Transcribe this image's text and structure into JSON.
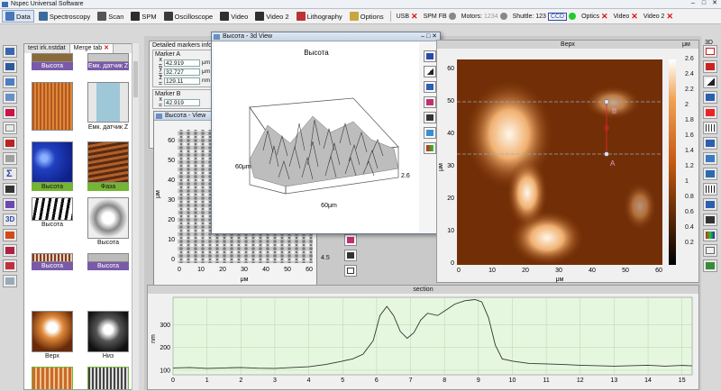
{
  "app": {
    "title": "Nspec Universal Software"
  },
  "toolbar": {
    "items": [
      "Data",
      "Spectroscopy",
      "Scan",
      "SPM",
      "Oscilloscope",
      "Video",
      "Video 2",
      "Lithography",
      "Options"
    ],
    "usb": "USB",
    "spm_fb": "SPM FB",
    "motors": "Motors:",
    "motors_value": "1234",
    "shuttle": "Shuttle: 123",
    "ccd": "CCD",
    "optics": "Optics",
    "video": "Video",
    "video2": "Video 2"
  },
  "gallery": {
    "tabs": [
      "test irk.nstdat",
      "Merge tab"
    ],
    "thumbs": [
      {
        "label": "Высота"
      },
      {
        "label": "Емк. датчик Z"
      },
      {
        "label": ""
      },
      {
        "label": "Емк. датчик Z"
      },
      {
        "label": "Высота"
      },
      {
        "label": "Фаза"
      },
      {
        "label": "Высота"
      },
      {
        "label": "Высота"
      },
      {
        "label": "Высота"
      },
      {
        "label": "Высота"
      },
      {
        "label": "Верх"
      },
      {
        "label": "Низ"
      }
    ]
  },
  "markers": {
    "title": "Detailed markers info",
    "a": {
      "label": "Marker A",
      "x": "42.919",
      "y": "32.727",
      "z": "129.11",
      "ux": "μm",
      "uy": "μm",
      "uz": "nm"
    },
    "b": {
      "label": "Marker B",
      "x": "42.919"
    }
  },
  "view2d": {
    "title": "Высота - View",
    "y_unit": "μм",
    "x_unit": "μм",
    "y_ticks": [
      "60",
      "50",
      "40",
      "30",
      "20",
      "10",
      "0"
    ],
    "x_ticks": [
      "0",
      "10",
      "20",
      "30",
      "40",
      "50",
      "60"
    ],
    "colorbar_tick": "4.5"
  },
  "view3d": {
    "title": "Высота - 3d View",
    "plot_title": "Высота",
    "left_axis": "60μm",
    "right_axis": "2.6",
    "bottom_axis": "60μm"
  },
  "verh": {
    "title": "Верх",
    "x_unit": "μм",
    "y_unit": "μм",
    "x_ticks": [
      "0",
      "10",
      "20",
      "30",
      "40",
      "50",
      "60"
    ],
    "y_ticks": [
      "60",
      "50",
      "40",
      "30",
      "20",
      "10",
      "0"
    ],
    "marker_a": "A",
    "marker_b": "B",
    "colorbar_unit": "μм",
    "colorbar_ticks": [
      "2.6",
      "2.4",
      "2.2",
      "2",
      "1.8",
      "1.6",
      "1.4",
      "1.2",
      "1",
      "0.8",
      "0.6",
      "0.4",
      "0.2"
    ]
  },
  "right_bar": {
    "label": "3D"
  },
  "section": {
    "title": "section",
    "ylabel": "nm",
    "x_ticks": [
      "0",
      "1",
      "2",
      "3",
      "4",
      "5",
      "6",
      "7",
      "8",
      "9",
      "10",
      "11",
      "12",
      "13",
      "14",
      "15"
    ],
    "y_ticks": [
      "100",
      "200",
      "300"
    ]
  },
  "chart_data": {
    "type": "line",
    "title": "section",
    "xlabel": "",
    "ylabel": "nm",
    "xlim": [
      0,
      15.3
    ],
    "ylim": [
      80,
      420
    ],
    "x": [
      0,
      0.5,
      1,
      1.5,
      2,
      2.5,
      3,
      3.5,
      4,
      4.5,
      5,
      5.3,
      5.6,
      5.9,
      6.1,
      6.3,
      6.5,
      6.7,
      6.9,
      7.1,
      7.3,
      7.5,
      7.8,
      8,
      8.3,
      8.6,
      8.9,
      9.1,
      9.3,
      9.5,
      9.7,
      10,
      10.5,
      11,
      11.5,
      12,
      12.5,
      13,
      13.5,
      14,
      14.5,
      15,
      15.3
    ],
    "y": [
      110,
      112,
      108,
      110,
      112,
      109,
      108,
      112,
      115,
      125,
      140,
      150,
      170,
      230,
      340,
      380,
      340,
      270,
      240,
      265,
      320,
      350,
      340,
      360,
      390,
      405,
      410,
      400,
      330,
      210,
      150,
      140,
      130,
      128,
      125,
      122,
      120,
      118,
      120,
      122,
      118,
      121,
      119
    ],
    "grid": true
  }
}
